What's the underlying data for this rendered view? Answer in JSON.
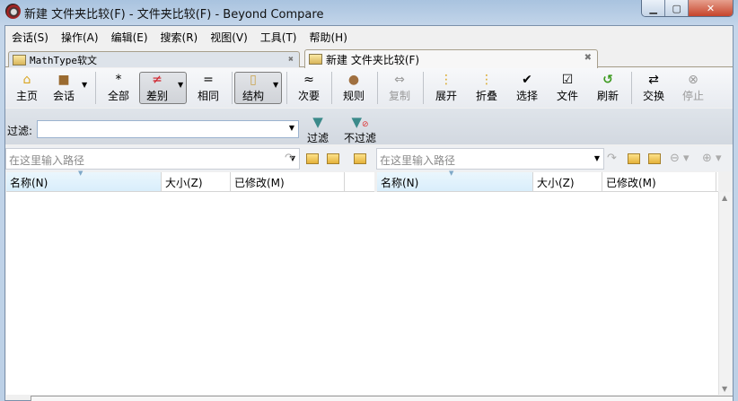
{
  "window": {
    "title": "新建 文件夹比较(F) - 文件夹比较(F) - Beyond Compare",
    "minimize": "▁",
    "maximize": "▢",
    "close": "✕"
  },
  "menu": [
    "会话(S)",
    "操作(A)",
    "编辑(E)",
    "搜索(R)",
    "视图(V)",
    "工具(T)",
    "帮助(H)"
  ],
  "tabs": [
    {
      "label": "MathType软文",
      "close": "✖"
    },
    {
      "label": "新建 文件夹比较(F)",
      "close": "✖"
    }
  ],
  "toolbar": {
    "home": {
      "icon": "⌂",
      "label": "主页"
    },
    "session": {
      "icon": "■",
      "label": "会话"
    },
    "all": {
      "icon": "*",
      "label": "全部"
    },
    "diffs": {
      "icon": "≠",
      "label": "差别"
    },
    "same": {
      "icon": "=",
      "label": "相同"
    },
    "structure": {
      "icon": "▯",
      "label": "结构"
    },
    "minor": {
      "icon": "≈",
      "label": "次要"
    },
    "rules": {
      "icon": "●",
      "label": "规则"
    },
    "copy": {
      "icon": "⇔",
      "label": "复制"
    },
    "expand": {
      "icon": "⋮",
      "label": "展开"
    },
    "collapse": {
      "icon": "⋮",
      "label": "折叠"
    },
    "select": {
      "icon": "✔",
      "label": "选择"
    },
    "files": {
      "icon": "☑",
      "label": "文件"
    },
    "refresh": {
      "icon": "↺",
      "label": "刷新"
    },
    "swap": {
      "icon": "⇄",
      "label": "交换"
    },
    "stop": {
      "icon": "⊗",
      "label": "停止"
    },
    "dropdown": "▼"
  },
  "filter": {
    "label": "过滤:",
    "value": "",
    "filter_btn": "过滤",
    "nofilter_btn": "不过滤"
  },
  "left_pane": {
    "path_placeholder": "在这里输入路径",
    "columns": [
      "名称(N)",
      "大小(Z)",
      "已修改(M)"
    ]
  },
  "right_pane": {
    "path_placeholder": "在这里输入路径",
    "columns": [
      "名称(N)",
      "大小(Z)",
      "已修改(M)"
    ]
  },
  "colors": {
    "accent": "#3c9a1e",
    "diff": "#d0202a"
  }
}
